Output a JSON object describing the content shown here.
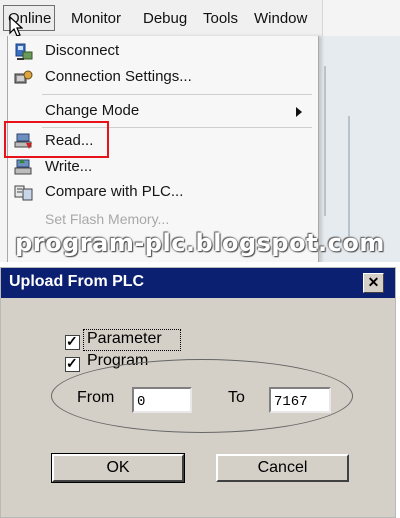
{
  "menubar": {
    "items": [
      {
        "label": "Online"
      },
      {
        "label": "Monitor"
      },
      {
        "label": "Debug"
      },
      {
        "label": "Tools"
      },
      {
        "label": "Window"
      }
    ]
  },
  "menu": {
    "items": [
      {
        "label": "Disconnect",
        "icon": "disconnect-icon"
      },
      {
        "label": "Connection Settings...",
        "icon": "connection-settings-icon"
      },
      {
        "label": "Change Mode",
        "submenu": true
      },
      {
        "label": "Read...",
        "icon": "read-icon",
        "highlighted": true
      },
      {
        "label": "Write...",
        "icon": "write-icon"
      },
      {
        "label": "Compare with PLC...",
        "icon": "compare-icon"
      },
      {
        "label": "Set Flash Memory...",
        "disabled": true
      }
    ]
  },
  "watermark": "program-plc.blogspot.com",
  "dialog": {
    "title": "Upload From PLC",
    "parameter_label": "Parameter",
    "parameter_checked": true,
    "program_label": "Program",
    "program_checked": true,
    "from_label": "From",
    "from_value": "0",
    "to_label": "To",
    "to_value": "7167",
    "ok_label": "OK",
    "cancel_label": "Cancel"
  },
  "colors": {
    "highlight": "#e8121b",
    "titlebar": "#0b2070",
    "dialog_face": "#d4d0c8"
  }
}
